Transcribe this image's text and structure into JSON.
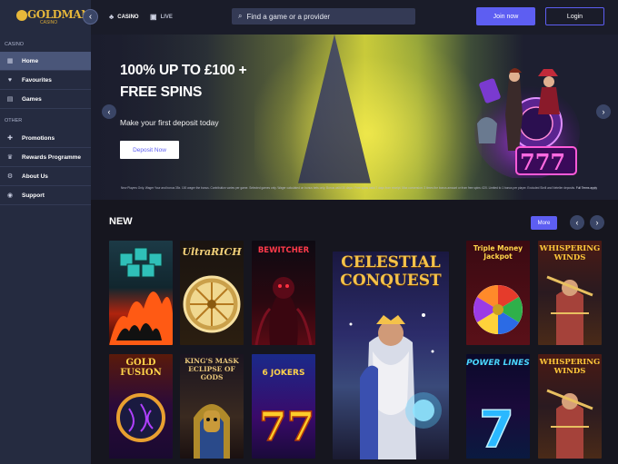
{
  "brand": {
    "logo_text": "GOLDMAN",
    "logo_sub": "CASINO"
  },
  "sidebar": {
    "casino_label": "CASINO",
    "other_label": "OTHER",
    "items": [
      {
        "label": "Home",
        "icon": "grid-icon"
      },
      {
        "label": "Favourites",
        "icon": "heart-icon"
      },
      {
        "label": "Games",
        "icon": "games-icon"
      },
      {
        "label": "Promotions",
        "icon": "gift-icon"
      },
      {
        "label": "Rewards Programme",
        "icon": "trophy-icon"
      },
      {
        "label": "About Us",
        "icon": "gear-icon"
      },
      {
        "label": "Support",
        "icon": "support-icon"
      }
    ]
  },
  "topbar": {
    "tab_casino": "CASINO",
    "tab_live": "LIVE",
    "search_placeholder": "Find a game or a provider",
    "join_label": "Join now",
    "login_label": "Login"
  },
  "hero": {
    "title_line1": "100% UP TO £100 +",
    "title_line2": "FREE SPINS",
    "subtitle": "Make your first deposit today",
    "cta_label": "Deposit Now",
    "terms": "New Players Only. Wager Your and bonus 35x. 100 wager the bonus. Contribution varies per game. Selected games only. Wager calculated on bonus bets only. Bonus valid 30 days / Free spins valid 7 days from receipt. Max conversion: 3 times the bonus amount or from free spins: £20. Limited to 1 bonus per player. Excluded Skrill and Neteller deposits.",
    "terms_link": "Full Terms apply"
  },
  "new_section": {
    "title": "NEW",
    "more_label": "More"
  },
  "games": [
    {
      "title": "",
      "theme": "skulls"
    },
    {
      "title": "UltraRICH",
      "theme": "ultrarich"
    },
    {
      "title": "BEWITCHER",
      "theme": "bewitcher"
    },
    {
      "title": "CELESTIAL CONQUEST",
      "theme": "celestial"
    },
    {
      "title": "Triple Money Jackpot",
      "theme": "triple"
    },
    {
      "title": "WHISPERING WINDS",
      "theme": "whispering"
    },
    {
      "title": "GOLD FUSION",
      "theme": "goldfusion"
    },
    {
      "title": "KING'S MASK ECLIPSE OF GODS",
      "theme": "kingsmask"
    },
    {
      "title": "6 JOKERS",
      "theme": "jokers"
    },
    {
      "title": "POWER LINES",
      "theme": "powerlines"
    },
    {
      "title": "WHISPERING WINDS",
      "theme": "whispering2"
    }
  ],
  "colors": {
    "accent": "#5d5ef2",
    "sidebar": "#252b40",
    "background": "#16161f",
    "gold": "#e6b73a"
  }
}
